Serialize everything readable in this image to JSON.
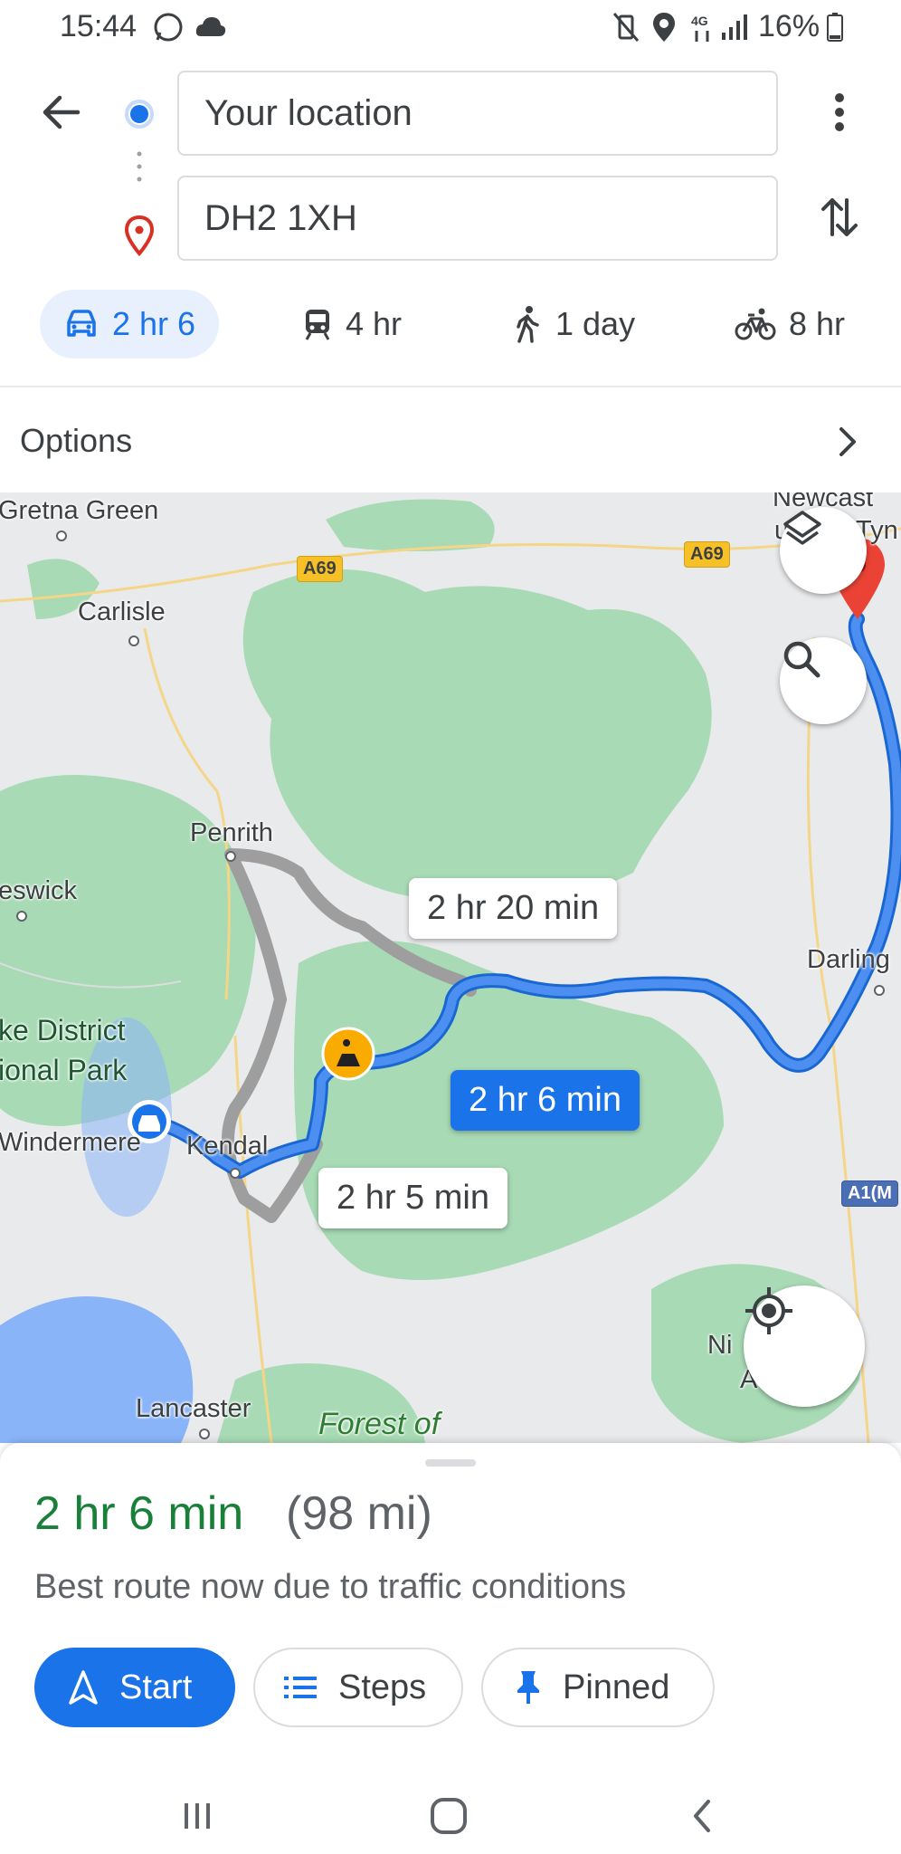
{
  "status_bar": {
    "time": "15:44",
    "battery": "16%"
  },
  "directions": {
    "origin_value": "Your location",
    "destination_value": "DH2 1XH"
  },
  "travel_modes": [
    {
      "mode": "car-icon",
      "label": "2 hr 6",
      "selected": true
    },
    {
      "mode": "train-icon",
      "label": "4 hr",
      "selected": false
    },
    {
      "mode": "walk-icon",
      "label": "1 day",
      "selected": false
    },
    {
      "mode": "bicycle-icon",
      "label": "8 hr",
      "selected": false
    }
  ],
  "options_label": "Options",
  "map": {
    "places": {
      "gretna": "Gretna Green",
      "carlisle": "Carlisle",
      "penrith": "Penrith",
      "keswick": "eswick",
      "lake_district_1": "ke District",
      "lake_district_2": "ional Park",
      "windermere": "Windermere",
      "kendal": "Kendal",
      "lancaster": "Lancaster",
      "forest": "Forest of",
      "newcastle_1": "Newcast",
      "newcastle_2": "u",
      "newcastle_3": "Tyn",
      "darlington": "Darling",
      "ni": "Ni",
      "ao": "A",
      "a1m": "A1(M"
    },
    "roads": {
      "a69_west": "A69",
      "a69_east": "A69"
    },
    "route_callouts": {
      "alt1": "2 hr 20 min",
      "selected": "2 hr 6 min",
      "alt2": "2 hr 5 min"
    },
    "colors": {
      "route": "#1a73e8",
      "alt_route": "#9e9e9e",
      "park": "#a8dab5",
      "water": "#8ab4f8"
    }
  },
  "route_summary": {
    "duration": "2 hr 6 min",
    "distance": "(98 mi)",
    "reason": "Best route now due to traffic conditions"
  },
  "actions": {
    "start": "Start",
    "steps": "Steps",
    "pinned": "Pinned"
  }
}
